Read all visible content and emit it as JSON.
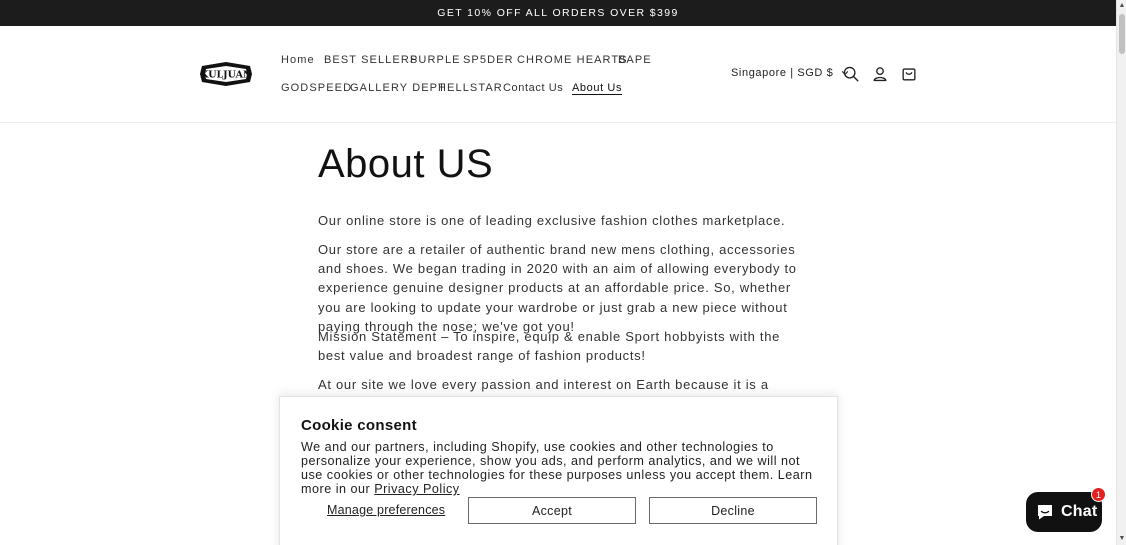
{
  "announcement": "GET 10% OFF ALL ORDERS OVER $399",
  "brand": {
    "logo_text": "KULJUAN"
  },
  "nav": {
    "row1": [
      "Home",
      "BEST SELLERS",
      "PURPLE",
      "SP5DER",
      "CHROME HEARTS",
      "BAPE"
    ],
    "row2": [
      "GODSPEED",
      "GALLERY DEPT",
      "HELLSTAR",
      "Contact Us",
      "About Us"
    ],
    "active": "About Us"
  },
  "localization": "Singapore | SGD $",
  "header_icons": [
    "search-icon",
    "account-icon",
    "cart-icon"
  ],
  "page": {
    "title": "About US",
    "paragraphs": [
      "Our online store is one of leading exclusive fashion clothes marketplace.",
      "Our store are a retailer of authentic brand new mens clothing, accessories and shoes. We began trading in 2020 with an aim of allowing everybody to experience genuine designer products at an affordable price. So, whether you are looking to update your wardrobe or just grab a new piece without paying through the nose; we've got you!",
      "Mission Statement – To inspire, equip & enable Sport hobbyists with the best value and broadest range of fashion products!",
      "At our site we love every passion and interest on Earth because it is a reference to your"
    ]
  },
  "cookie": {
    "title": "Cookie consent",
    "text": "We and our partners, including Shopify, use cookies and other technologies to personalize your experience, show you ads, and perform analytics, and we will not use cookies or other technologies for these purposes unless you accept them. Learn more in our",
    "link": "Privacy Policy",
    "manage": "Manage preferences",
    "accept": "Accept",
    "decline": "Decline"
  },
  "chat": {
    "label": "Chat",
    "badge": "1"
  },
  "colors": {
    "announcement_bg": "#1c1c1c",
    "chat_bg": "#111111",
    "badge": "#e22120"
  }
}
